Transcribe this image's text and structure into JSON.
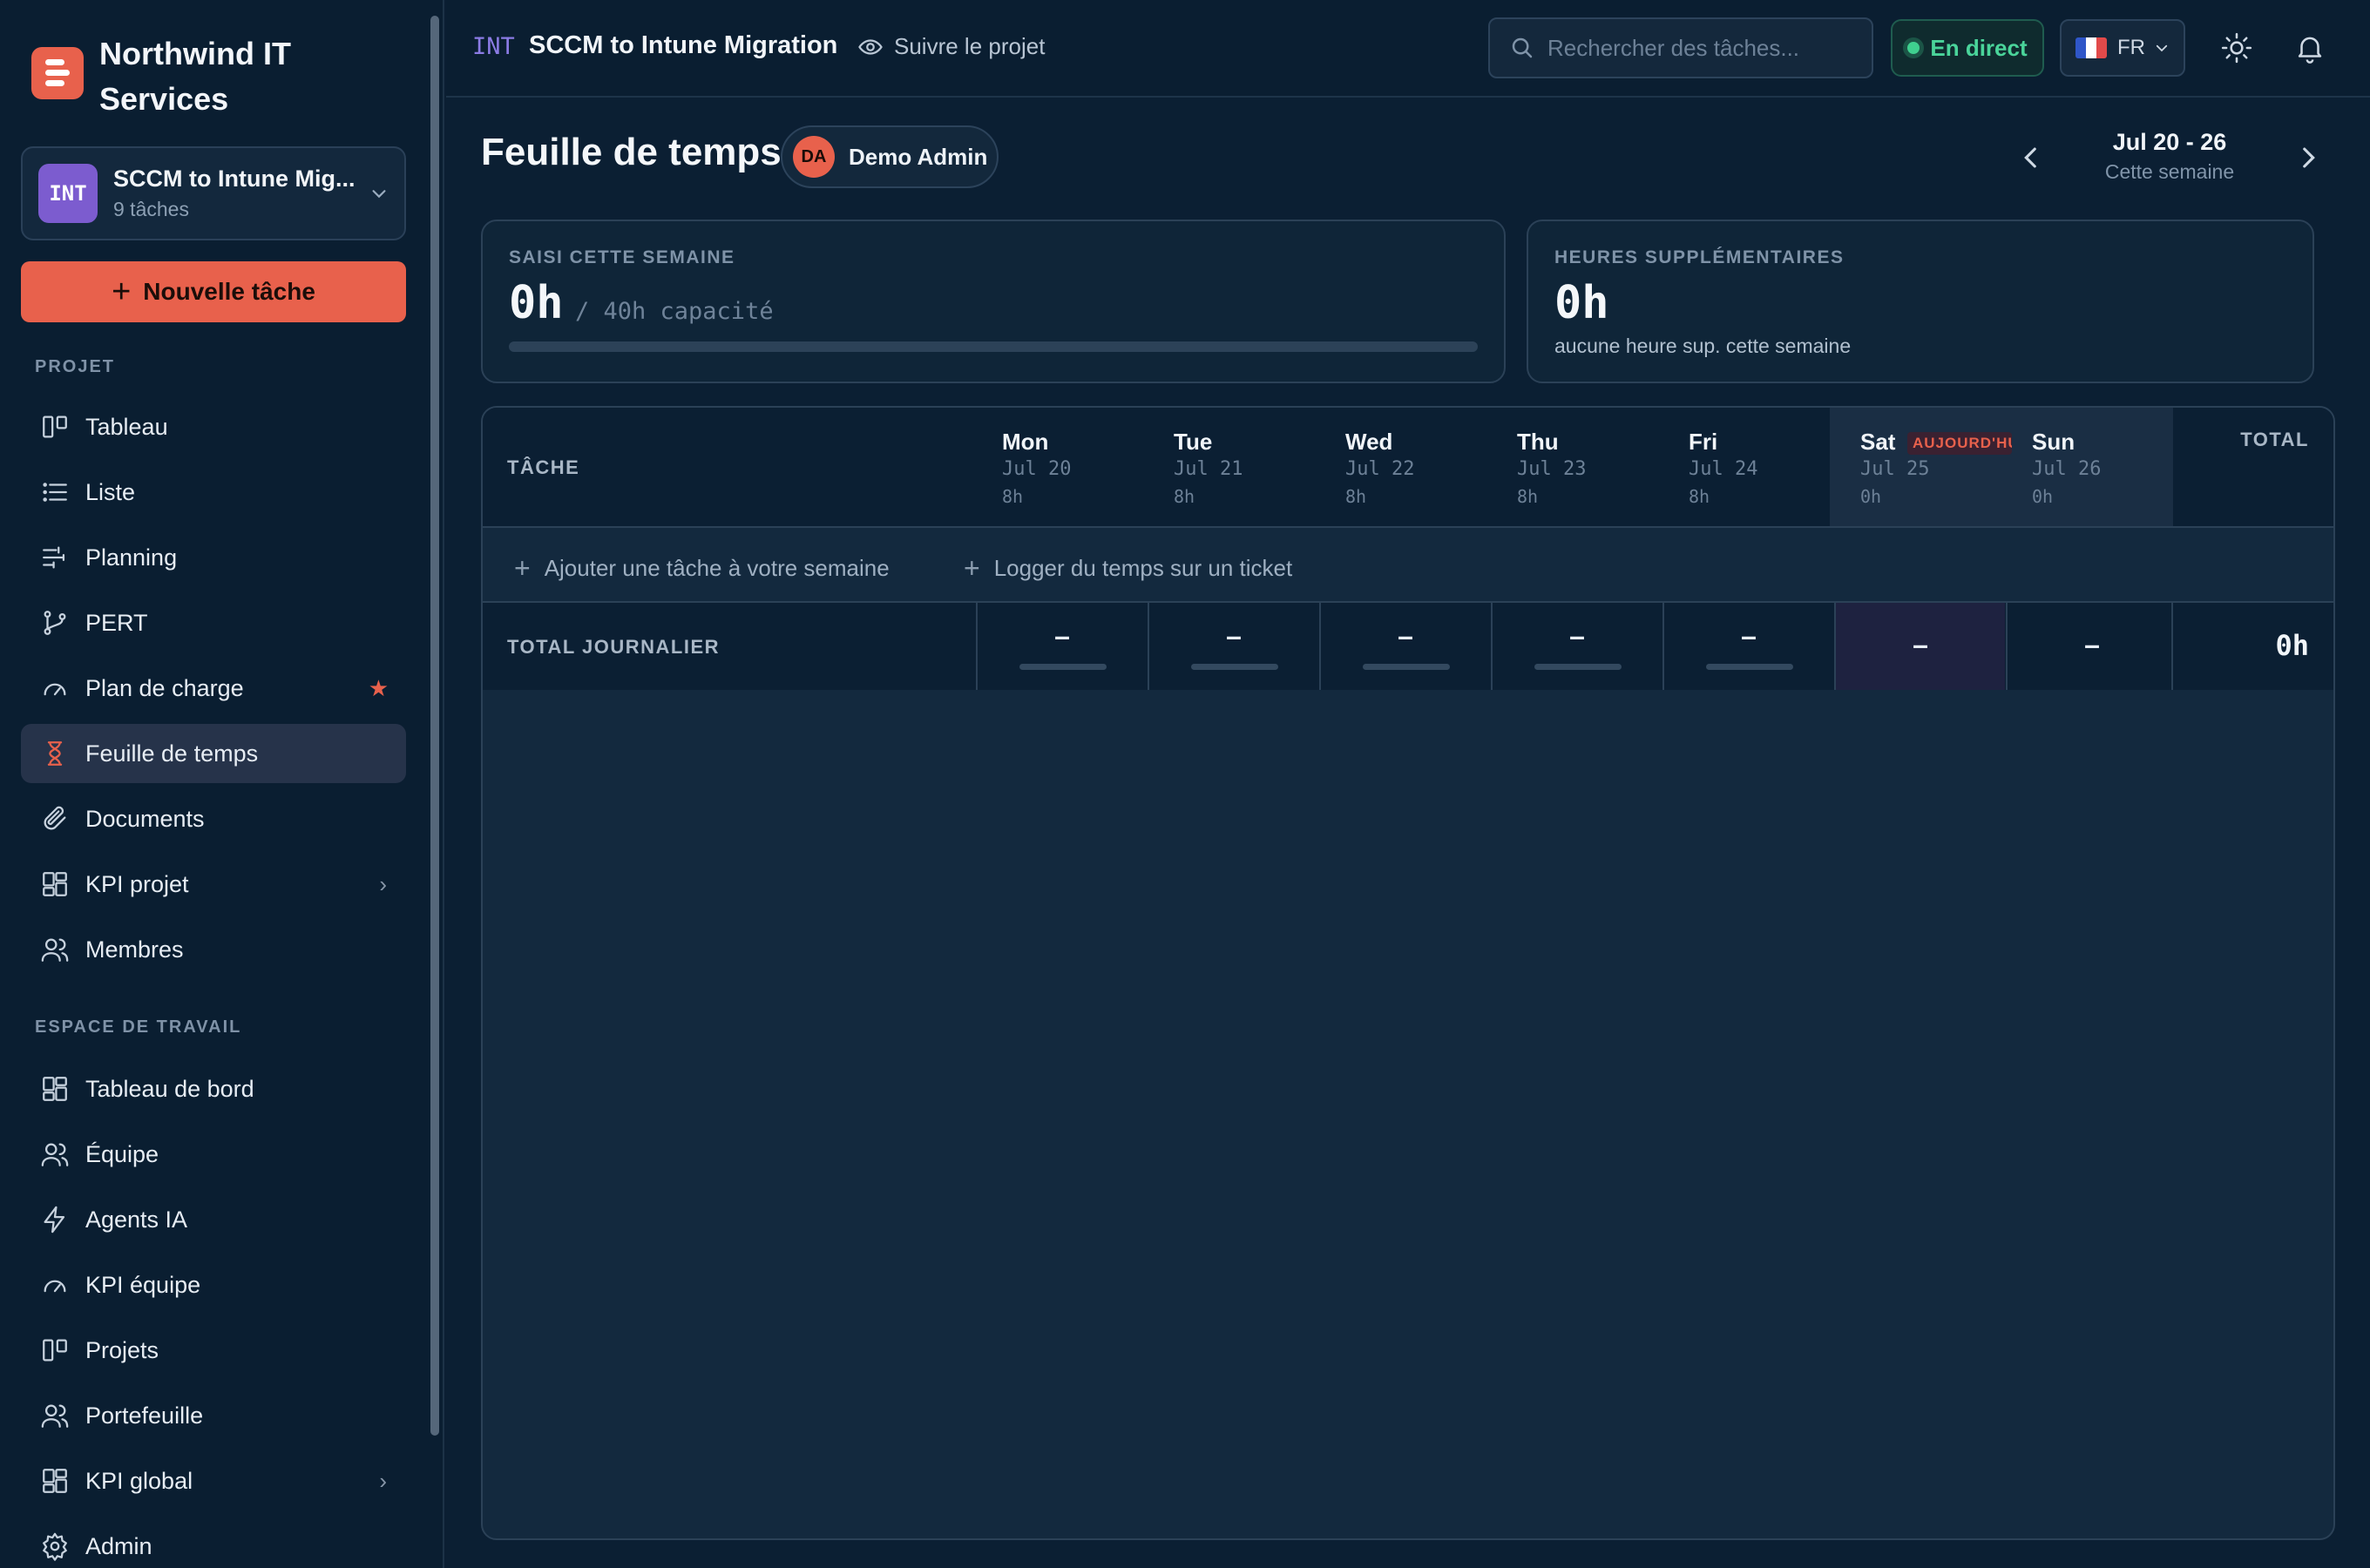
{
  "brand": {
    "name": "Northwind IT Services"
  },
  "project_switcher": {
    "code": "INT",
    "name": "SCCM to Intune Mig...",
    "subtitle": "9 tâches"
  },
  "new_task_label": "Nouvelle tâche",
  "sidebar": {
    "project_section": "PROJET",
    "project_items": [
      {
        "label": "Tableau",
        "icon": "board-icon"
      },
      {
        "label": "Liste",
        "icon": "list-icon"
      },
      {
        "label": "Planning",
        "icon": "gantt-icon"
      },
      {
        "label": "PERT",
        "icon": "branch-icon"
      },
      {
        "label": "Plan de charge",
        "icon": "gauge-icon",
        "badge": "★"
      },
      {
        "label": "Feuille de temps",
        "icon": "hourglass-icon",
        "active": true
      },
      {
        "label": "Documents",
        "icon": "paperclip-icon"
      },
      {
        "label": "KPI projet",
        "icon": "dashboard-icon",
        "trail": "›"
      },
      {
        "label": "Membres",
        "icon": "users-icon"
      }
    ],
    "workspace_section": "ESPACE DE TRAVAIL",
    "workspace_items": [
      {
        "label": "Tableau de bord",
        "icon": "dashboard-icon"
      },
      {
        "label": "Équipe",
        "icon": "users-icon"
      },
      {
        "label": "Agents IA",
        "icon": "bolt-icon"
      },
      {
        "label": "KPI équipe",
        "icon": "gauge-icon"
      },
      {
        "label": "Projets",
        "icon": "board-icon"
      },
      {
        "label": "Portefeuille",
        "icon": "users-icon"
      },
      {
        "label": "KPI global",
        "icon": "dashboard-icon",
        "trail": "›"
      },
      {
        "label": "Admin",
        "icon": "gear-icon"
      }
    ]
  },
  "topbar": {
    "project_code": "INT",
    "project_title": "SCCM to Intune Migration",
    "follow_label": "Suivre le projet",
    "search_placeholder": "Rechercher des tâches...",
    "live_label": "En direct",
    "language": "FR"
  },
  "page": {
    "title": "Feuille de temps",
    "user_initials": "DA",
    "user_name": "Demo Admin",
    "week_range": "Jul 20 - 26",
    "week_sub": "Cette semaine"
  },
  "summary": {
    "logged_label": "SAISI CETTE SEMAINE",
    "logged_value": "0h",
    "capacity": "/ 40h capacité",
    "progress_fraction": 0,
    "overtime_label": "HEURES SUPPLÉMENTAIRES",
    "overtime_value": "0h",
    "overtime_note": "aucune heure sup. cette semaine"
  },
  "grid": {
    "task_header": "TÂCHE",
    "total_header": "TOTAL",
    "today_badge": "AUJOURD'HUI",
    "days": [
      {
        "day": "Mon",
        "date": "Jul 20",
        "capacity": "8h",
        "value": "–"
      },
      {
        "day": "Tue",
        "date": "Jul 21",
        "capacity": "8h",
        "value": "–"
      },
      {
        "day": "Wed",
        "date": "Jul 22",
        "capacity": "8h",
        "value": "–"
      },
      {
        "day": "Thu",
        "date": "Jul 23",
        "capacity": "8h",
        "value": "–"
      },
      {
        "day": "Fri",
        "date": "Jul 24",
        "capacity": "8h",
        "value": "–"
      },
      {
        "day": "Sat",
        "date": "Jul 25",
        "capacity": "0h",
        "value": "–"
      },
      {
        "day": "Sun",
        "date": "Jul 26",
        "capacity": "0h",
        "value": "–"
      }
    ],
    "add_task_label": "Ajouter une tâche à votre semaine",
    "log_ticket_label": "Logger du temps sur un ticket",
    "daily_total_label": "TOTAL JOURNALIER",
    "week_total": "0h"
  }
}
